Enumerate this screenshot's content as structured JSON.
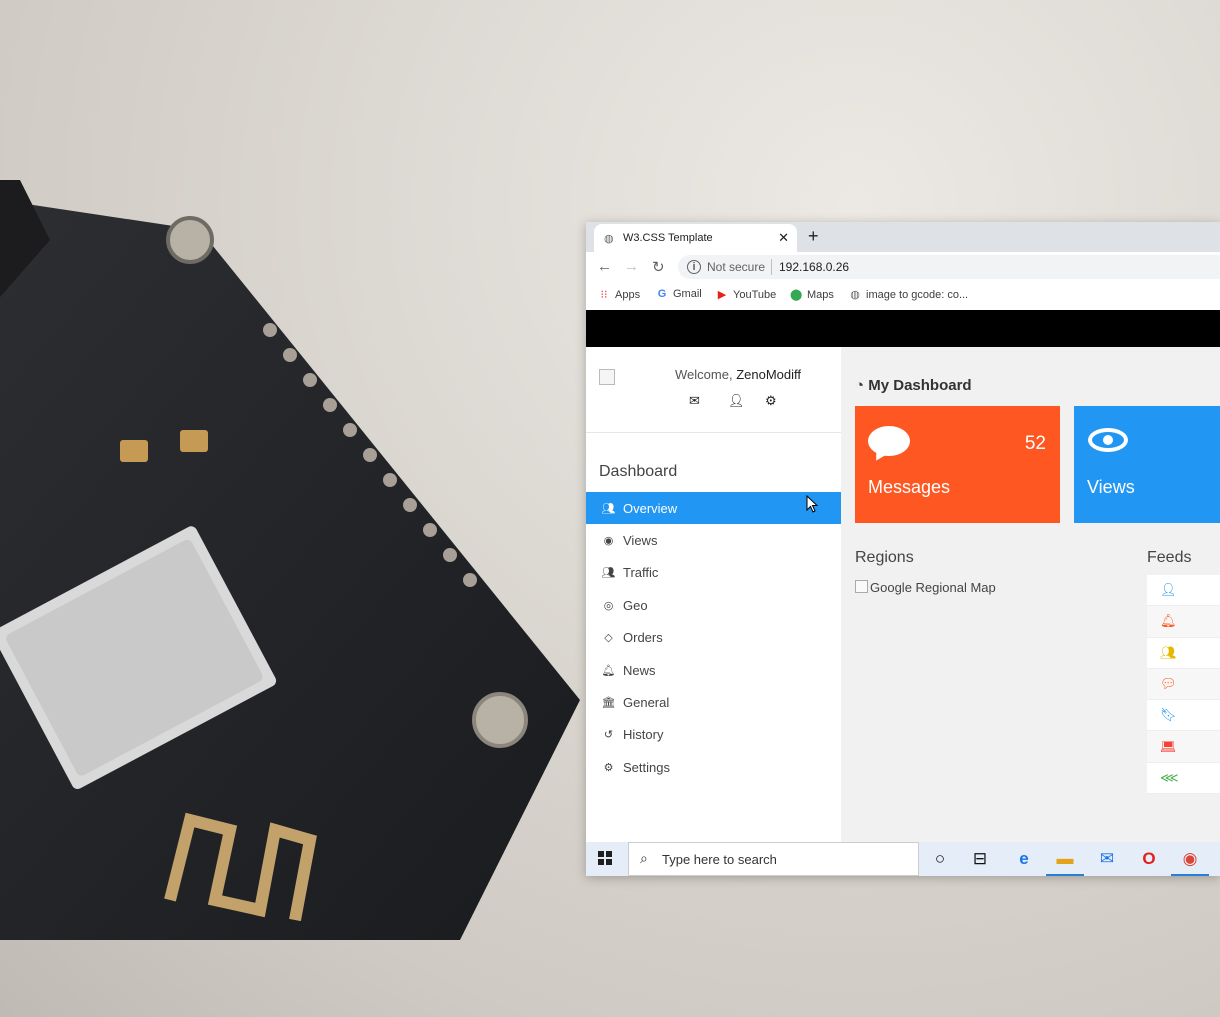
{
  "browser": {
    "tab_title": "W3.CSS Template",
    "new_tab": "+",
    "close_tab": "✕",
    "security_label": "Not secure",
    "url": "192.168.0.26",
    "bookmarks": [
      {
        "label": "Apps",
        "icon": "apps-grid-icon"
      },
      {
        "label": "Gmail",
        "icon": "google-icon"
      },
      {
        "label": "YouTube",
        "icon": "youtube-icon"
      },
      {
        "label": "Maps",
        "icon": "maps-pin-icon"
      },
      {
        "label": "image to gcode: co...",
        "icon": "globe-icon"
      }
    ]
  },
  "sidebar": {
    "welcome_prefix": "Welcome,",
    "username": "ZenoModiff",
    "section_title": "Dashboard",
    "menu": [
      {
        "label": "Overview",
        "icon": "users-icon",
        "active": true
      },
      {
        "label": "Views",
        "icon": "eye-icon"
      },
      {
        "label": "Traffic",
        "icon": "users-icon"
      },
      {
        "label": "Geo",
        "icon": "bullseye-icon"
      },
      {
        "label": "Orders",
        "icon": "diamond-icon"
      },
      {
        "label": "News",
        "icon": "bell-icon"
      },
      {
        "label": "General",
        "icon": "bank-icon"
      },
      {
        "label": "History",
        "icon": "history-icon"
      },
      {
        "label": "Settings",
        "icon": "cog-icon"
      }
    ]
  },
  "main": {
    "title": "My Dashboard",
    "cards": [
      {
        "label": "Messages",
        "count": "52",
        "color": "#ff5722",
        "icon": "comment-icon"
      },
      {
        "label": "Views",
        "color": "#2196f3",
        "icon": "eye-icon"
      }
    ],
    "regions_title": "Regions",
    "map_alt": "Google Regional Map",
    "feeds_title": "Feeds",
    "feed_icons": [
      {
        "icon": "user-icon",
        "color": "#2196f3"
      },
      {
        "icon": "bell-icon",
        "color": "#ff5722"
      },
      {
        "icon": "users-icon",
        "color": "#e6b800"
      },
      {
        "icon": "comment-icon",
        "color": "#ff5722"
      },
      {
        "icon": "bookmark-icon",
        "color": "#2196f3"
      },
      {
        "icon": "laptop-icon",
        "color": "#f44336"
      },
      {
        "icon": "share-icon",
        "color": "#4caf50"
      }
    ]
  },
  "taskbar": {
    "search_placeholder": "Type here to search"
  }
}
